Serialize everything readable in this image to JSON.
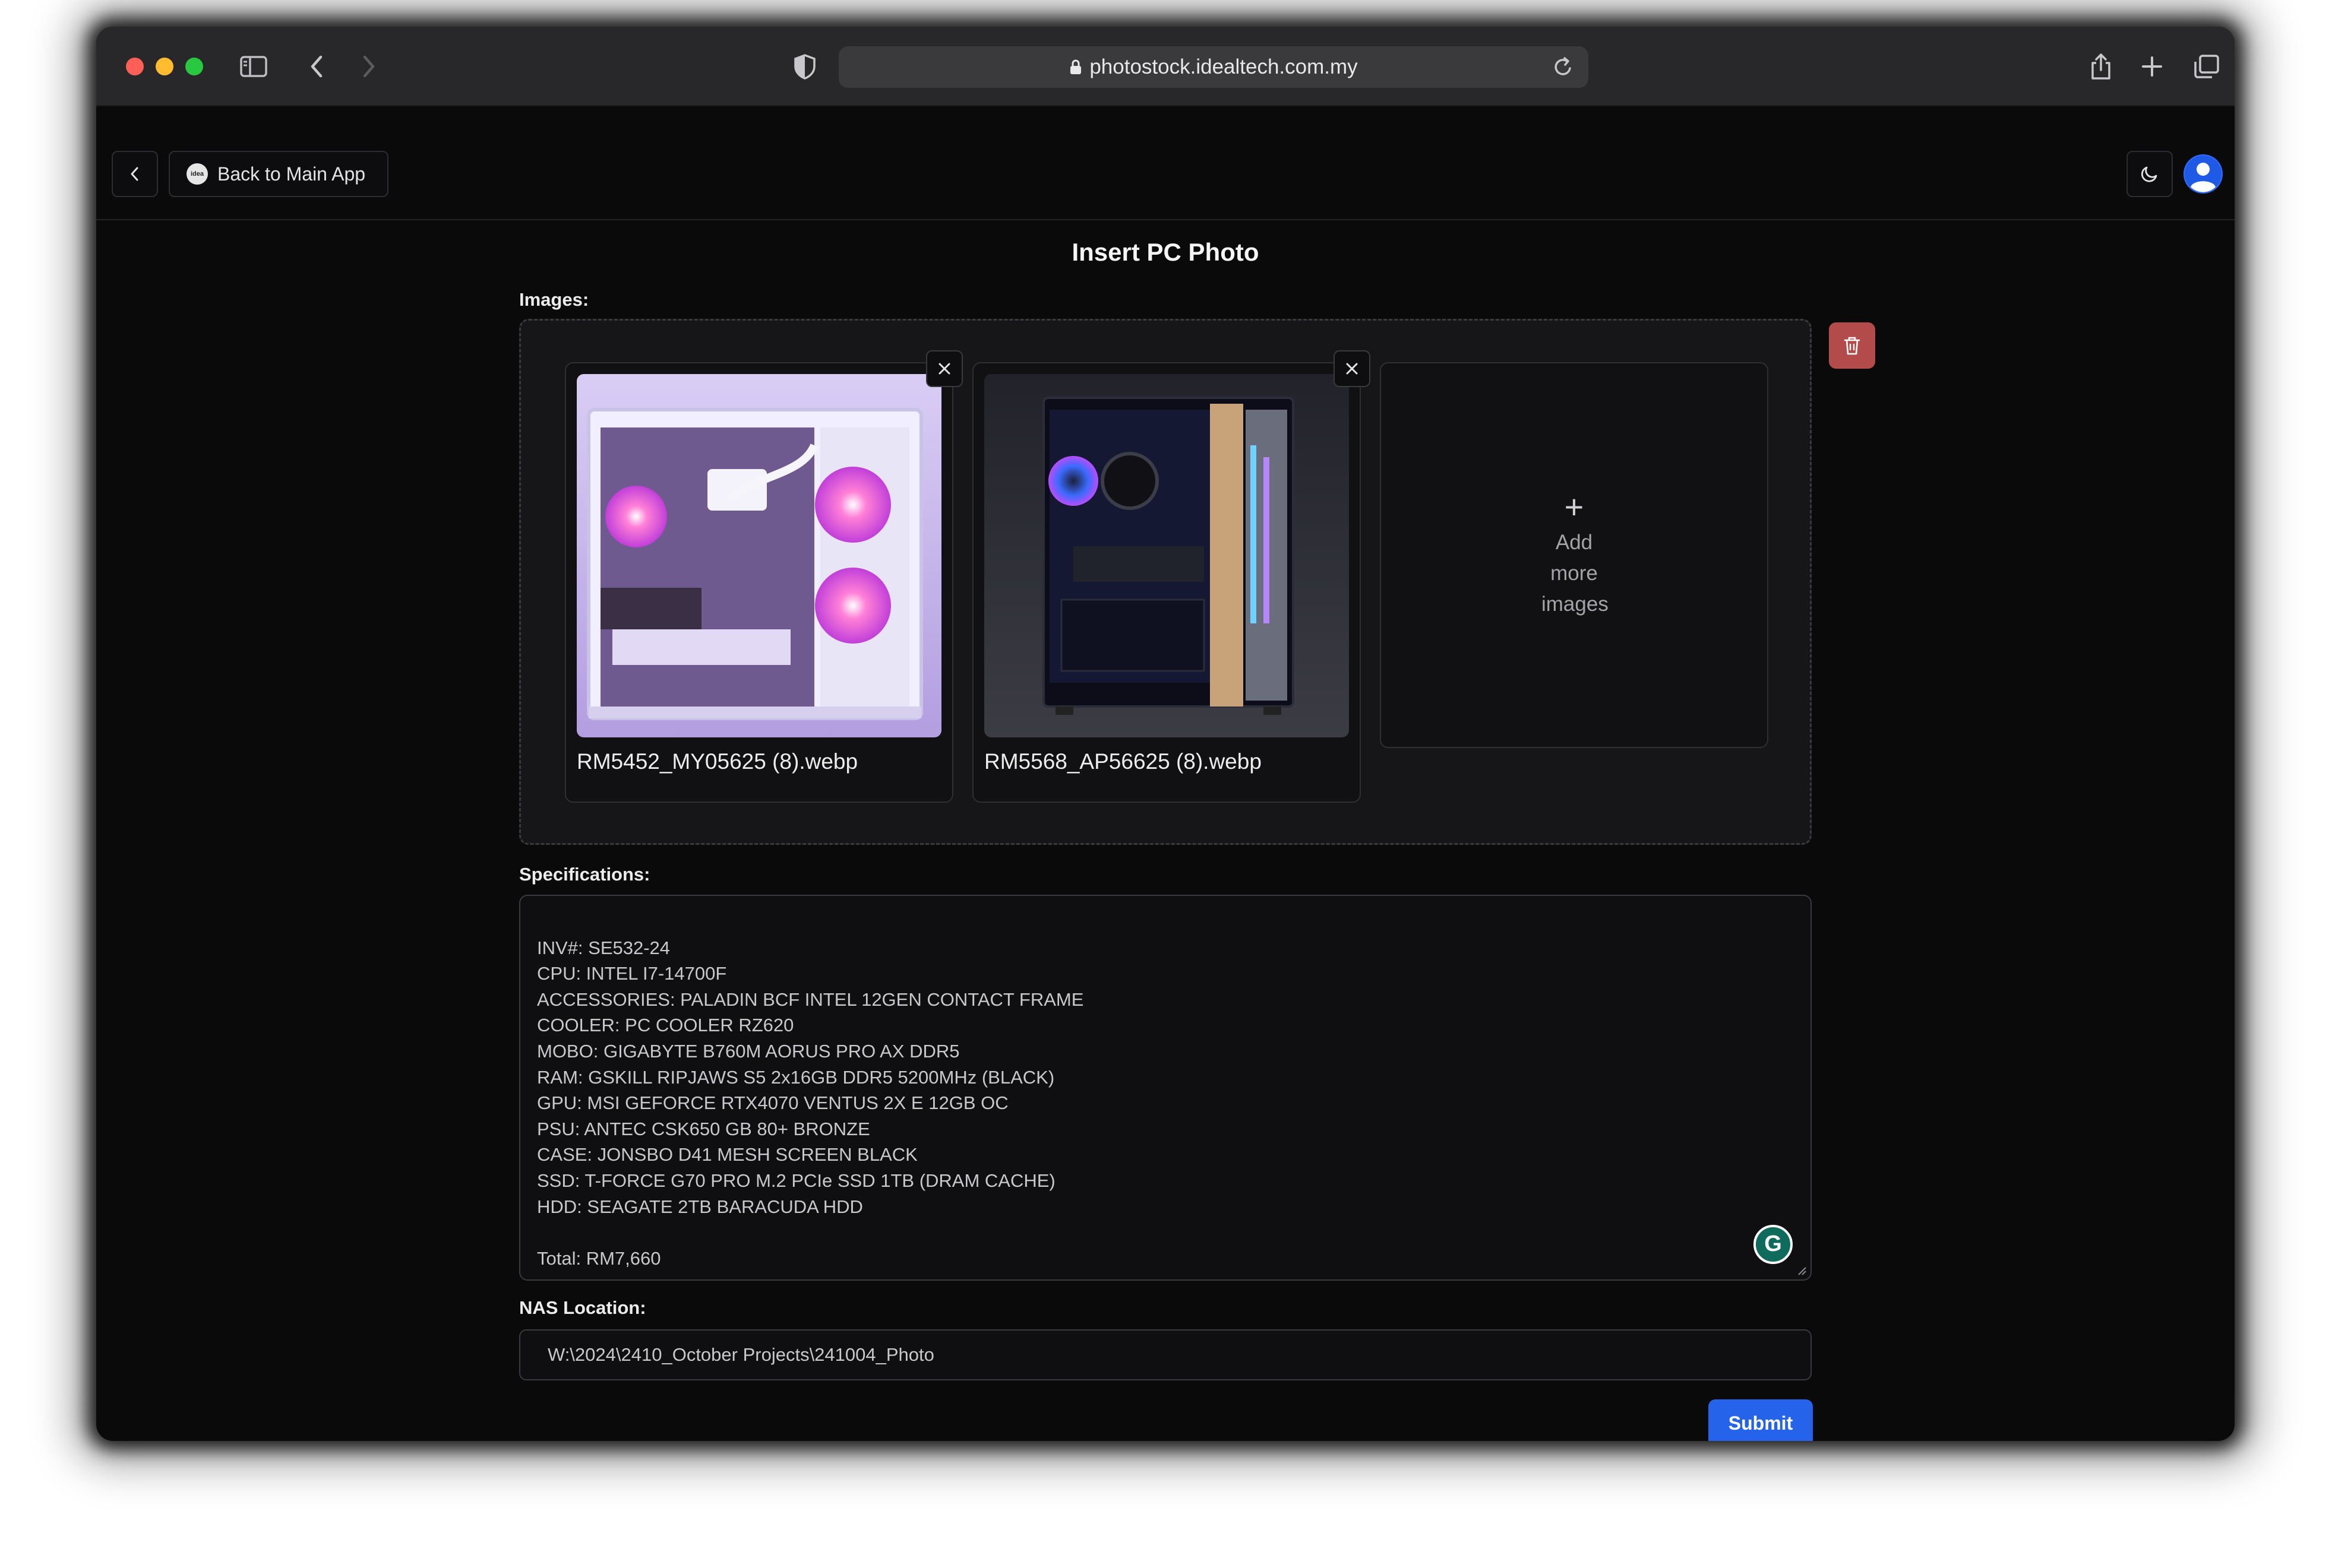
{
  "browser": {
    "url": "photostock.idealtech.com.my"
  },
  "header": {
    "back_main_label": "Back to Main App",
    "logo_text": "idea"
  },
  "page": {
    "title": "Insert PC Photo"
  },
  "images": {
    "label": "Images:",
    "files": [
      {
        "name": "RM5452_MY05625 (8).webp"
      },
      {
        "name": "RM5568_AP56625 (8).webp"
      }
    ],
    "add_more_label": "Add more images"
  },
  "specifications": {
    "label": "Specifications:",
    "text": "INV#: SE532-24\nCPU: INTEL I7-14700F\nACCESSORIES: PALADIN BCF INTEL 12GEN CONTACT FRAME\nCOOLER: PC COOLER RZ620\nMOBO: GIGABYTE B760M AORUS PRO AX DDR5\nRAM: GSKILL RIPJAWS S5 2x16GB DDR5 5200MHz (BLACK)\nGPU: MSI GEFORCE RTX4070 VENTUS 2X E 12GB OC\nPSU: ANTEC CSK650 GB 80+ BRONZE\nCASE: JONSBO D41 MESH SCREEN BLACK\nSSD: T-FORCE G70 PRO M.2 PCIe SSD 1TB (DRAM CACHE)\nHDD: SEAGATE 2TB BARACUDA HDD\n\nTotal: RM7,660"
  },
  "nas": {
    "label": "NAS Location:",
    "value": "W:\\2024\\2410_October Projects\\241004_Photo"
  },
  "actions": {
    "submit_label": "Submit"
  },
  "colors": {
    "accent": "#2563eb",
    "danger": "#b34b4b",
    "background": "#0a0a0b"
  }
}
